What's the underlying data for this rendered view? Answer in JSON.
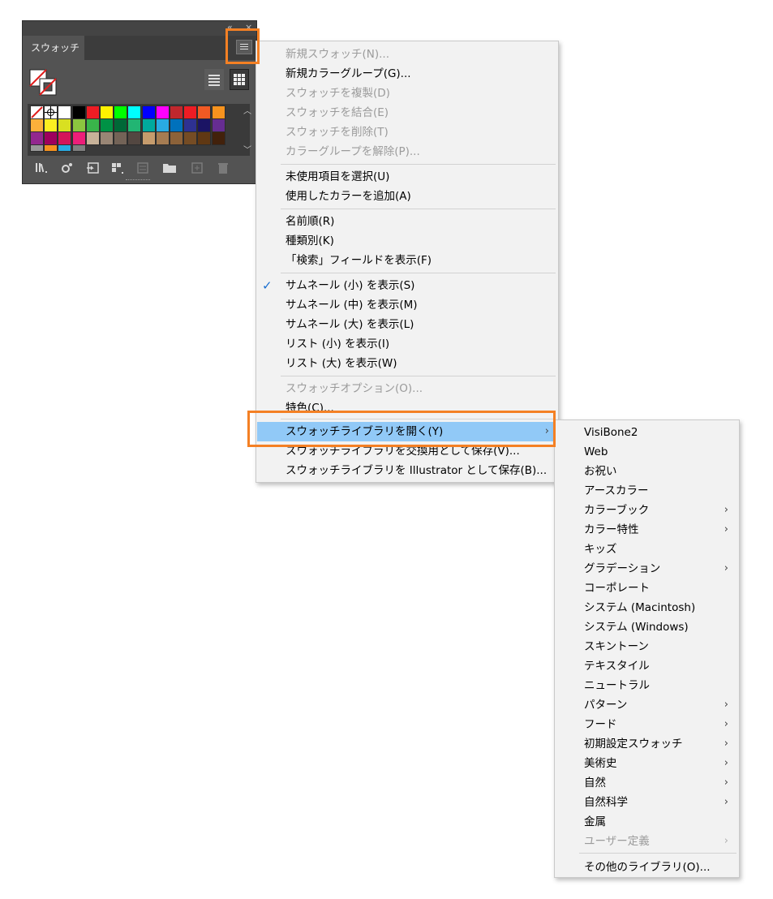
{
  "panel": {
    "tab_label": "スウォッチ",
    "collapse_glyph": "«",
    "close_glyph": "×",
    "swatches": [
      [
        "#ffffff",
        "#ffffff",
        "#ffffff",
        "#000000",
        "#ed1c24",
        "#fff200",
        "#00ff00",
        "#00ffff",
        "#0000ff",
        "#ff00ff",
        "#c1272d",
        "#ed1c24",
        "#f15a24",
        "#f7931e"
      ],
      [
        "#fbb03b",
        "#fcee21",
        "#d9e021",
        "#8cc63f",
        "#39b54a",
        "#009245",
        "#006837",
        "#22b573",
        "#00a99d",
        "#29abe2",
        "#0071bc",
        "#2e3192",
        "#1b1464",
        "#662d91"
      ],
      [
        "#93278f",
        "#9e005d",
        "#d4145a",
        "#ed1e79",
        "#c7b299",
        "#998675",
        "#736357",
        "#534741",
        "#c69c6d",
        "#a67c52",
        "#8c6239",
        "#754c24",
        "#603813",
        "#42210b"
      ],
      [
        "#999999",
        "#f7931e",
        "#29abe2",
        "#808080"
      ]
    ]
  },
  "main_menu": {
    "items": [
      {
        "label": "新規スウォッチ(N)...",
        "disabled": true
      },
      {
        "label": "新規カラーグループ(G)...",
        "disabled": false
      },
      {
        "label": "スウォッチを複製(D)",
        "disabled": true
      },
      {
        "label": "スウォッチを結合(E)",
        "disabled": true
      },
      {
        "label": "スウォッチを削除(T)",
        "disabled": true
      },
      {
        "label": "カラーグループを解除(P)...",
        "disabled": true
      },
      {
        "label": "未使用項目を選択(U)",
        "disabled": false
      },
      {
        "label": "使用したカラーを追加(A)",
        "disabled": false
      },
      {
        "label": "名前順(R)",
        "disabled": false
      },
      {
        "label": "種類別(K)",
        "disabled": false
      },
      {
        "label": "「検索」フィールドを表示(F)",
        "disabled": false
      },
      {
        "label": "サムネール (小) を表示(S)",
        "disabled": false,
        "checked": true
      },
      {
        "label": "サムネール (中) を表示(M)",
        "disabled": false
      },
      {
        "label": "サムネール (大) を表示(L)",
        "disabled": false
      },
      {
        "label": "リスト (小) を表示(I)",
        "disabled": false
      },
      {
        "label": "リスト (大) を表示(W)",
        "disabled": false
      },
      {
        "label": "スウォッチオプション(O)...",
        "disabled": true
      },
      {
        "label": "特色(C)...",
        "disabled": false
      },
      {
        "label": "スウォッチライブラリを開く(Y)",
        "disabled": false,
        "highlighted": true,
        "submenu": true
      },
      {
        "label": "スウォッチライブラリを交換用として保存(V)...",
        "disabled": false
      },
      {
        "label": "スウォッチライブラリを Illustrator として保存(B)...",
        "disabled": false
      }
    ]
  },
  "sub_menu": {
    "items": [
      {
        "label": "VisiBone2"
      },
      {
        "label": "Web"
      },
      {
        "label": "お祝い"
      },
      {
        "label": "アースカラー"
      },
      {
        "label": "カラーブック",
        "submenu": true
      },
      {
        "label": "カラー特性",
        "submenu": true
      },
      {
        "label": "キッズ"
      },
      {
        "label": "グラデーション",
        "submenu": true
      },
      {
        "label": "コーポレート"
      },
      {
        "label": "システム (Macintosh)"
      },
      {
        "label": "システム (Windows)"
      },
      {
        "label": "スキントーン"
      },
      {
        "label": "テキスタイル"
      },
      {
        "label": "ニュートラル"
      },
      {
        "label": "パターン",
        "submenu": true
      },
      {
        "label": "フード",
        "submenu": true
      },
      {
        "label": "初期設定スウォッチ",
        "submenu": true
      },
      {
        "label": "美術史",
        "submenu": true
      },
      {
        "label": "自然",
        "submenu": true
      },
      {
        "label": "自然科学",
        "submenu": true
      },
      {
        "label": "金属"
      },
      {
        "label": "ユーザー定義",
        "submenu": true,
        "disabled": true
      },
      {
        "label": "その他のライブラリ(O)..."
      }
    ]
  },
  "glyphs": {
    "check": "✓",
    "submenu_arrow": "›"
  },
  "colors": {
    "highlight": "#91c9f7",
    "annotation": "#f48024",
    "panel_bg": "#535353"
  }
}
